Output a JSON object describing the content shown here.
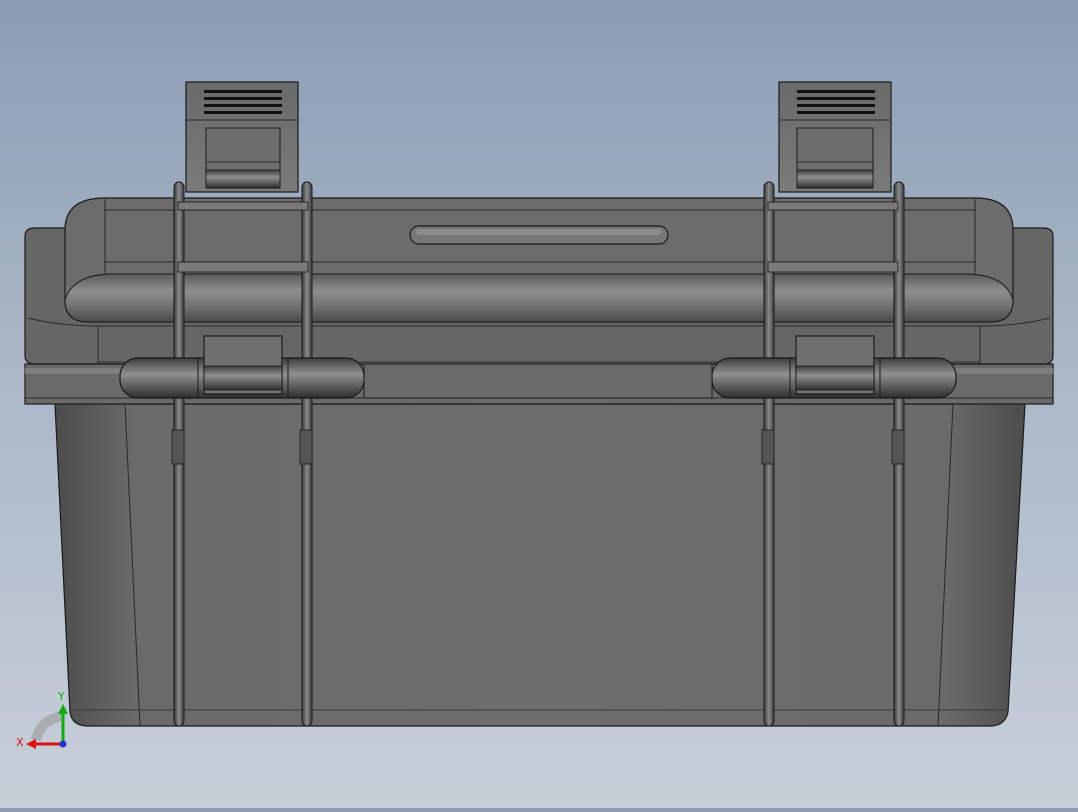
{
  "viewport": {
    "background_top": "#8b9db3",
    "background_bottom": "#c7cfd9",
    "model": {
      "body_color": "#6b6b6b",
      "edge_color": "#1a1a1a",
      "highlight_color": "#9a9a9a"
    }
  },
  "triad": {
    "x_label": "X",
    "y_label": "Y",
    "x_color": "#d11",
    "y_color": "#1a1",
    "z_color": "#23c"
  }
}
